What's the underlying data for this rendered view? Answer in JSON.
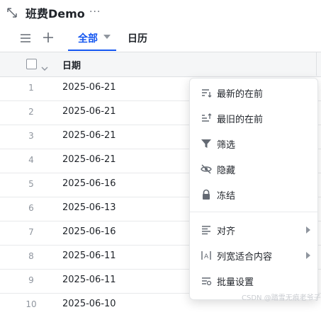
{
  "header": {
    "title": "班费Demo",
    "more": "···"
  },
  "toolbar": {
    "tabs": [
      {
        "label": "全部",
        "active": true
      },
      {
        "label": "日历",
        "active": false
      }
    ]
  },
  "table": {
    "column_header": "日期",
    "rows": [
      {
        "index": "1",
        "date": "2025-06-21"
      },
      {
        "index": "2",
        "date": "2025-06-21"
      },
      {
        "index": "3",
        "date": "2025-06-21"
      },
      {
        "index": "4",
        "date": "2025-06-21"
      },
      {
        "index": "5",
        "date": "2025-06-16"
      },
      {
        "index": "6",
        "date": "2025-06-13"
      },
      {
        "index": "7",
        "date": "2025-06-16"
      },
      {
        "index": "8",
        "date": "2025-06-11"
      },
      {
        "index": "9",
        "date": "2025-06-11"
      },
      {
        "index": "10",
        "date": "2025-06-10"
      }
    ]
  },
  "menu": {
    "items": [
      {
        "label": "最新的在前",
        "icon": "sort-desc-icon"
      },
      {
        "label": "最旧的在前",
        "icon": "sort-asc-icon"
      },
      {
        "label": "筛选",
        "icon": "filter-icon"
      },
      {
        "label": "隐藏",
        "icon": "eye-off-icon"
      },
      {
        "label": "冻结",
        "icon": "lock-icon"
      },
      {
        "label": "对齐",
        "icon": "align-icon",
        "submenu": true
      },
      {
        "label": "列宽适合内容",
        "icon": "column-width-icon",
        "submenu": true
      },
      {
        "label": "批量设置",
        "icon": "batch-settings-icon"
      }
    ]
  },
  "watermark": "CSDN @踏雪无痕老爷子",
  "colors": {
    "accent": "#1456f0",
    "text": "#1f2329",
    "muted": "#8f959e",
    "header_bg": "#f5f6f7"
  }
}
